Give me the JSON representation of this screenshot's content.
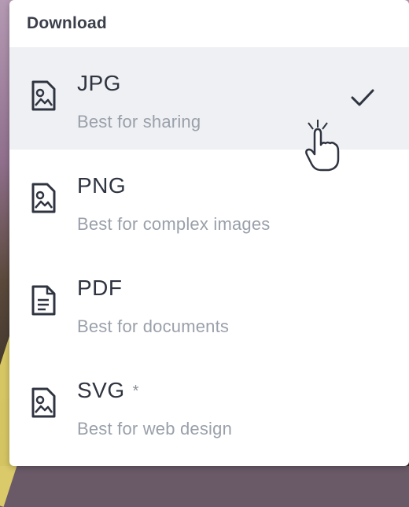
{
  "panel": {
    "title": "Download"
  },
  "formats": [
    {
      "label": "JPG",
      "description": "Best for sharing",
      "icon": "image-file-icon",
      "selected": true
    },
    {
      "label": "PNG",
      "description": "Best for complex images",
      "icon": "image-file-icon",
      "selected": false
    },
    {
      "label": "PDF",
      "description": "Best for documents",
      "icon": "document-file-icon",
      "selected": false
    },
    {
      "label": "SVG",
      "description": "Best for web design",
      "icon": "image-file-icon",
      "selected": false,
      "badge": "*"
    }
  ],
  "colors": {
    "selected_bg": "#eef0f3",
    "title_text": "#2f3440",
    "sub_text": "#9aa0aa"
  }
}
